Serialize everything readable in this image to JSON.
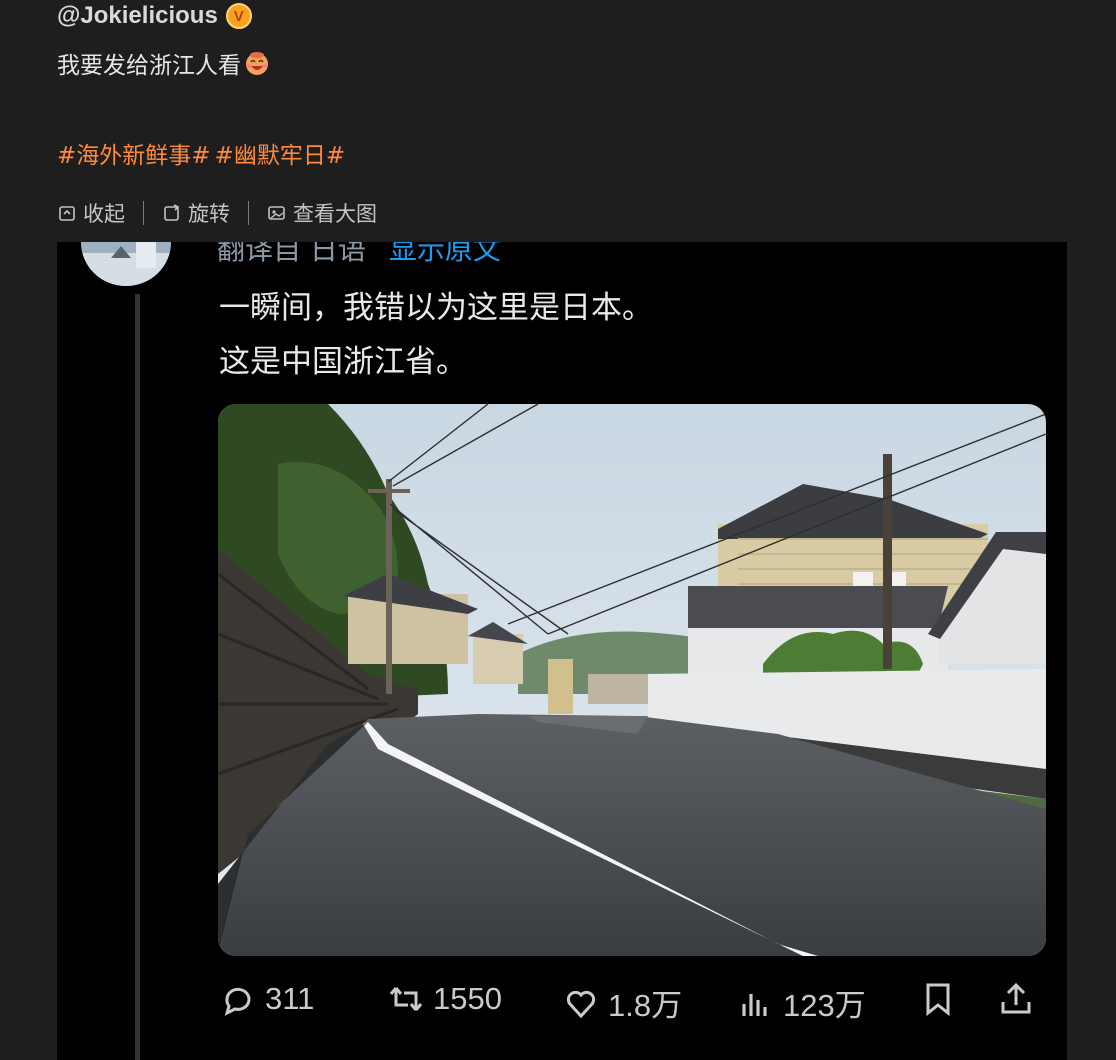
{
  "post": {
    "username": "@Jokielicious",
    "verified_icon": "v-badge-icon",
    "text": "我要发给浙江人看",
    "emoji": "laughing-emoji-icon",
    "hashtags": [
      "#海外新鲜事#",
      "#幽默牢日#"
    ]
  },
  "toolbar": {
    "collapse_label": "收起",
    "rotate_label": "旋转",
    "view_large_label": "查看大图"
  },
  "embed": {
    "translate_label": "翻译自 日语",
    "show_original_label": "显示原文",
    "tweet_lines": [
      "一瞬间，我错以为这里是日本。",
      "这是中国浙江省。"
    ],
    "stats": {
      "replies": "311",
      "retweets": "1550",
      "likes": "1.8万",
      "views": "123万"
    }
  },
  "colors": {
    "background": "#1e1e1e",
    "hashtag": "#ff8a3d",
    "embed_bg": "#000000",
    "link": "#1d9bf0"
  }
}
